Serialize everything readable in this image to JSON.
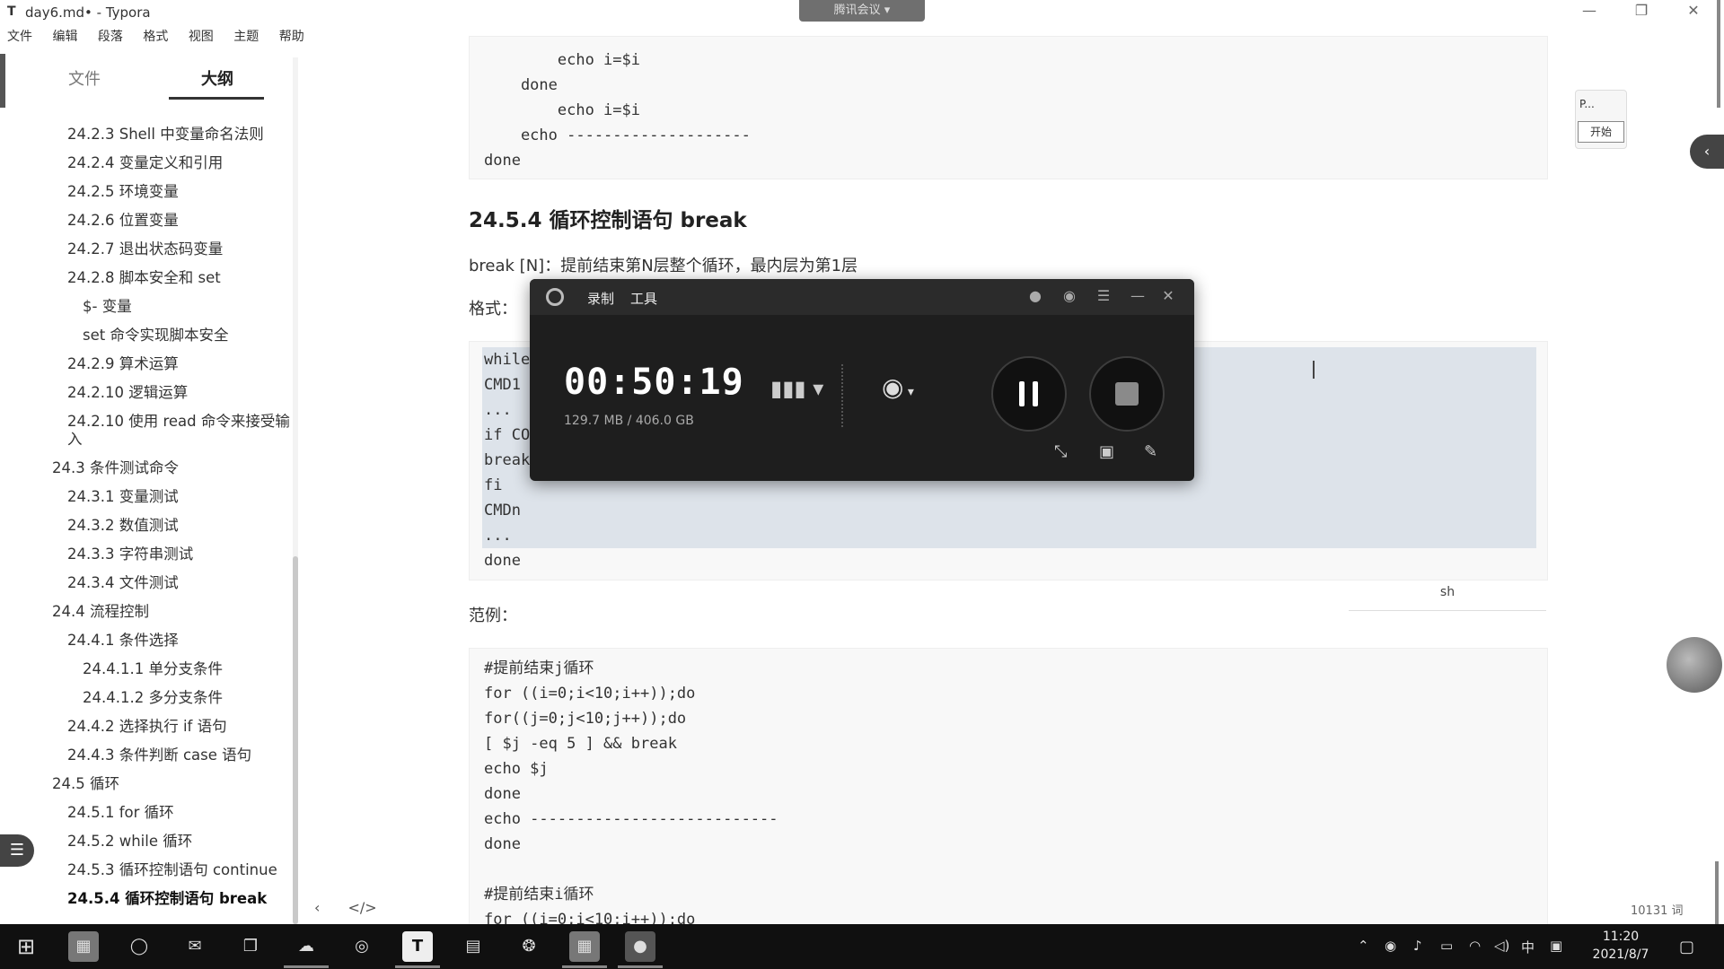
{
  "window": {
    "app_icon": "T",
    "title": "day6.md• - Typora",
    "meeting_tab": "腾讯会议"
  },
  "menu": [
    "文件",
    "编辑",
    "段落",
    "格式",
    "视图",
    "主题",
    "帮助"
  ],
  "sidebar": {
    "tabs": [
      "文件",
      "大纲"
    ],
    "outline": [
      {
        "text": "24.2.3 Shell 中变量命名法则",
        "level": 2
      },
      {
        "text": "24.2.4 变量定义和引用",
        "level": 2
      },
      {
        "text": "24.2.5 环境变量",
        "level": 2
      },
      {
        "text": "24.2.6 位置变量",
        "level": 2
      },
      {
        "text": "24.2.7 退出状态码变量",
        "level": 2
      },
      {
        "text": "24.2.8 脚本安全和 set",
        "level": 2
      },
      {
        "text": "$- 变量",
        "level": 3
      },
      {
        "text": "set 命令实现脚本安全",
        "level": 3
      },
      {
        "text": "24.2.9 算术运算",
        "level": 2
      },
      {
        "text": "24.2.10 逻辑运算",
        "level": 2
      },
      {
        "text": "24.2.10 使用 read 命令来接受输入",
        "level": 2
      },
      {
        "text": "24.3 条件测试命令",
        "level": 1
      },
      {
        "text": "24.3.1 变量测试",
        "level": 2
      },
      {
        "text": "24.3.2 数值测试",
        "level": 2
      },
      {
        "text": "24.3.3 字符串测试",
        "level": 2
      },
      {
        "text": "24.3.4 文件测试",
        "level": 2
      },
      {
        "text": "24.4 流程控制",
        "level": 1
      },
      {
        "text": "24.4.1 条件选择",
        "level": 2
      },
      {
        "text": "24.4.1.1 单分支条件",
        "level": 3
      },
      {
        "text": "24.4.1.2 多分支条件",
        "level": 3
      },
      {
        "text": "24.4.2 选择执行 if 语句",
        "level": 2
      },
      {
        "text": "24.4.3 条件判断 case 语句",
        "level": 2
      },
      {
        "text": "24.5 循环",
        "level": 1
      },
      {
        "text": "24.5.1 for 循环",
        "level": 2
      },
      {
        "text": "24.5.2 while 循环",
        "level": 2
      },
      {
        "text": "24.5.3 循环控制语句 continue",
        "level": 2
      },
      {
        "text": "24.5.4 循环控制语句 break",
        "level": 2,
        "active": true
      }
    ]
  },
  "content": {
    "top_code": [
      "        echo i=$i",
      "    done",
      "        echo i=$i",
      "    echo --------------------",
      "done"
    ],
    "heading": "24.5.4 循环控制语句 break",
    "desc": "break [N]：提前结束第N层整个循环，最内层为第1层",
    "format_label": "格式：",
    "format_code": [
      "while",
      "CMD1",
      "...",
      "if CO",
      "break",
      "fi",
      "CMDn",
      "...",
      "done"
    ],
    "code_lang": "sh",
    "example_label": "范例：",
    "example_code": [
      "#提前结束j循环",
      "for ((i=0;i<10;i++));do",
      "for((j=0;j<10;j++));do",
      "[ $j -eq 5 ] && break",
      "echo $j",
      "done",
      "echo ---------------------------",
      "done",
      "",
      "#提前结束i循环",
      "for ((i=0;i<10;i++));do"
    ]
  },
  "recorder": {
    "tabs": [
      "录制",
      "工具"
    ],
    "time": "00:50:19",
    "storage": "129.7 MB / 406.0 GB"
  },
  "widget": {
    "label": "P...",
    "start": "开始"
  },
  "status": {
    "word_count": "10131 词"
  },
  "taskbar": {
    "time": "11:20",
    "date": "2021/8/7",
    "ime": "中"
  }
}
